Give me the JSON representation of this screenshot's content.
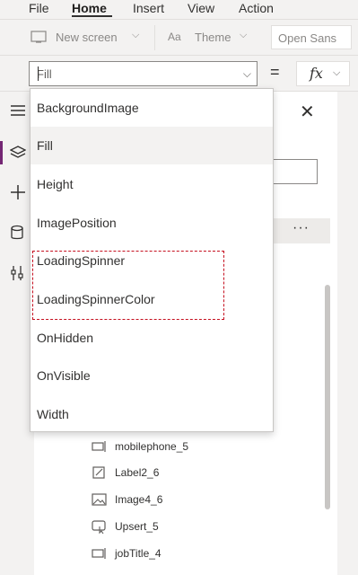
{
  "menu": {
    "items": [
      "File",
      "Home",
      "Insert",
      "View",
      "Action"
    ],
    "active": "Home"
  },
  "toolbar": {
    "new_screen": "New screen",
    "theme": "Theme",
    "font": "Open Sans"
  },
  "formula_bar": {
    "property": "Fill",
    "equals": "=",
    "fx": "fx"
  },
  "dropdown": {
    "options": [
      "BackgroundImage",
      "Fill",
      "Height",
      "ImagePosition",
      "LoadingSpinner",
      "LoadingSpinnerColor",
      "OnHidden",
      "OnVisible",
      "Width"
    ],
    "selected": "Fill",
    "highlighted": [
      "LoadingSpinner",
      "LoadingSpinnerColor"
    ]
  },
  "tree": {
    "items": [
      {
        "label": "mobilephone_5",
        "icon": "text-input-icon"
      },
      {
        "label": "Label2_6",
        "icon": "edit-label-icon"
      },
      {
        "label": "Image4_6",
        "icon": "image-icon"
      },
      {
        "label": "Upsert_5",
        "icon": "button-icon"
      },
      {
        "label": "jobTitle_4",
        "icon": "text-input-icon"
      }
    ],
    "more": "···"
  },
  "colors": {
    "accent": "#742774",
    "highlight_border": "#c50f1f"
  }
}
